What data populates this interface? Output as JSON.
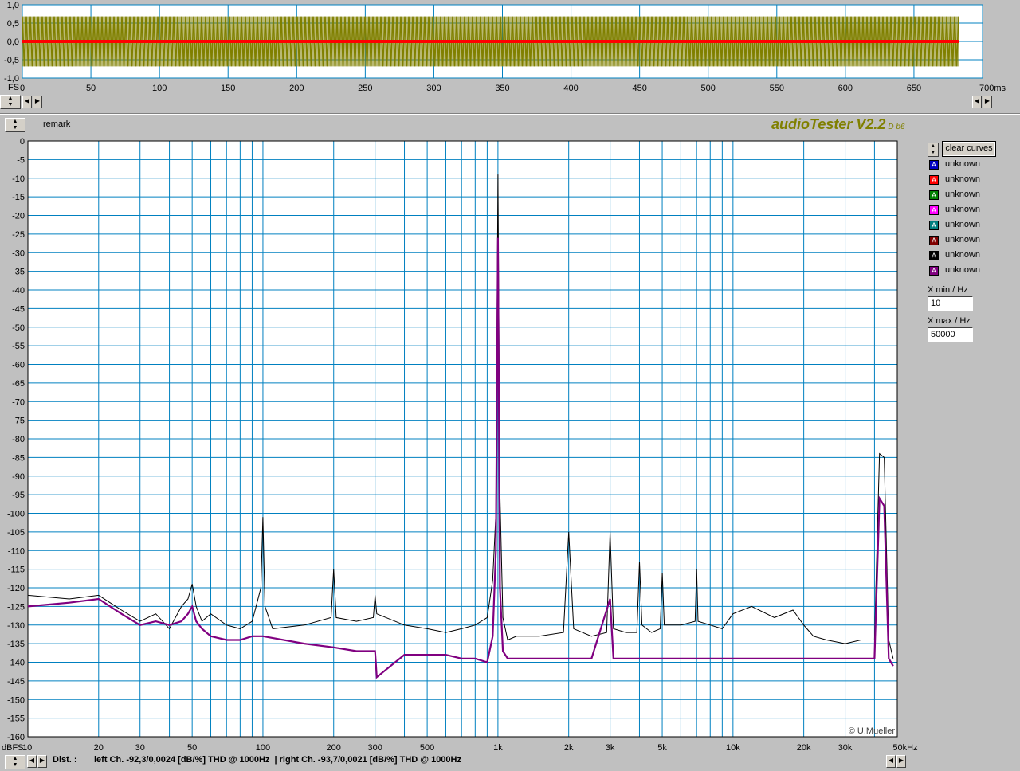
{
  "scope": {
    "y_labels": [
      "1,0",
      "0,5",
      "0,0",
      "-0,5",
      "-1,0"
    ],
    "fs_label": "FS",
    "x_ticks": [
      "0",
      "50",
      "100",
      "150",
      "200",
      "250",
      "300",
      "350",
      "400",
      "450",
      "500",
      "550",
      "600",
      "650",
      "700ms"
    ],
    "colors": {
      "bg": "#ffffff",
      "grid": "#0080c0",
      "wave": "#808000",
      "center": "#ff0000"
    }
  },
  "toolbar": {
    "remark_label": "remark",
    "app_title": "audioTester V2.2",
    "app_version": "D b6",
    "clear_button": "clear curves"
  },
  "spectrum": {
    "y_unit": "dBFS",
    "y_ticks": [
      "0",
      "-5",
      "-10",
      "-15",
      "-20",
      "-25",
      "-30",
      "-35",
      "-40",
      "-45",
      "-50",
      "-55",
      "-60",
      "-65",
      "-70",
      "-75",
      "-80",
      "-85",
      "-90",
      "-95",
      "-100",
      "-105",
      "-110",
      "-115",
      "-120",
      "-125",
      "-130",
      "-135",
      "-140",
      "-145",
      "-150",
      "-155",
      "-160"
    ],
    "x_ticks": [
      {
        "label": "10",
        "f": 10
      },
      {
        "label": "20",
        "f": 20
      },
      {
        "label": "30",
        "f": 30
      },
      {
        "label": "50",
        "f": 50
      },
      {
        "label": "100",
        "f": 100
      },
      {
        "label": "200",
        "f": 200
      },
      {
        "label": "300",
        "f": 300
      },
      {
        "label": "500",
        "f": 500
      },
      {
        "label": "1k",
        "f": 1000
      },
      {
        "label": "2k",
        "f": 2000
      },
      {
        "label": "3k",
        "f": 3000
      },
      {
        "label": "5k",
        "f": 5000
      },
      {
        "label": "10k",
        "f": 10000
      },
      {
        "label": "20k",
        "f": 20000
      },
      {
        "label": "30k",
        "f": 30000
      },
      {
        "label": "50kHz",
        "f": 50000
      }
    ],
    "copyright": "© U.Mueller"
  },
  "legend": [
    {
      "label": "unknown",
      "color": "#0000c0",
      "icon": "triangle-icon"
    },
    {
      "label": "unknown",
      "color": "#ff0000",
      "icon": "triangle-icon"
    },
    {
      "label": "unknown",
      "color": "#008000",
      "icon": "triangle-icon"
    },
    {
      "label": "unknown",
      "color": "#ff00ff",
      "icon": "triangle-icon"
    },
    {
      "label": "unknown",
      "color": "#008080",
      "icon": "triangle-icon"
    },
    {
      "label": "unknown",
      "color": "#800000",
      "icon": "triangle-icon"
    },
    {
      "label": "unknown",
      "color": "#000000",
      "icon": "triangle-icon"
    },
    {
      "label": "unknown",
      "color": "#800080",
      "icon": "triangle-icon"
    }
  ],
  "controls": {
    "xmin_label": "X min / Hz",
    "xmin_value": "10",
    "xmax_label": "X max / Hz",
    "xmax_value": "50000"
  },
  "status": {
    "dist_label": "Dist. :",
    "dist_text": "left Ch. -92,3/0,0024 [dB/%] THD @ 1000Hz  | right Ch. -93,7/0,0021 [dB/%] THD @ 1000Hz"
  },
  "chart_data": {
    "type": "line",
    "title": "",
    "xlabel": "",
    "ylabel": "dBFS",
    "x_scale": "log",
    "xlim": [
      10,
      50000
    ],
    "ylim": [
      -160,
      0
    ],
    "grid": true,
    "series": [
      {
        "color": "#000000",
        "x": [
          10,
          15,
          20,
          25,
          30,
          35,
          40,
          45,
          48,
          50,
          52,
          55,
          60,
          70,
          80,
          90,
          98,
          100,
          102,
          110,
          150,
          195,
          200,
          205,
          250,
          295,
          300,
          305,
          400,
          500,
          600,
          700,
          800,
          900,
          950,
          980,
          1000,
          1020,
          1050,
          1100,
          1200,
          1500,
          1900,
          2000,
          2100,
          2500,
          2900,
          3000,
          3100,
          3500,
          3900,
          4000,
          4100,
          4500,
          4900,
          5000,
          5100,
          6000,
          6900,
          7000,
          7100,
          8000,
          9000,
          10000,
          12000,
          15000,
          18000,
          20000,
          22000,
          25000,
          30000,
          35000,
          40000,
          42000,
          44000,
          46000,
          48000
        ],
        "y": [
          -122,
          -123,
          -122,
          -126,
          -129,
          -127,
          -131,
          -125,
          -123,
          -119,
          -125,
          -129,
          -127,
          -130,
          -131,
          -129,
          -120,
          -101,
          -125,
          -131,
          -130,
          -128,
          -115,
          -128,
          -129,
          -128,
          -122,
          -127,
          -130,
          -131,
          -132,
          -131,
          -130,
          -128,
          -118,
          -100,
          -9,
          -95,
          -128,
          -134,
          -133,
          -133,
          -132,
          -105,
          -131,
          -133,
          -132,
          -105,
          -131,
          -132,
          -132,
          -113,
          -130,
          -132,
          -131,
          -116,
          -130,
          -130,
          -129,
          -115,
          -129,
          -130,
          -131,
          -127,
          -125,
          -128,
          -126,
          -130,
          -133,
          -134,
          -135,
          -134,
          -134,
          -84,
          -85,
          -134,
          -139
        ]
      },
      {
        "color": "#800080",
        "x": [
          10,
          15,
          20,
          25,
          30,
          35,
          40,
          45,
          48,
          50,
          52,
          55,
          60,
          70,
          80,
          90,
          100,
          150,
          200,
          250,
          300,
          305,
          400,
          500,
          600,
          700,
          800,
          900,
          950,
          980,
          1000,
          1020,
          1050,
          1100,
          1200,
          1500,
          2000,
          2500,
          3000,
          3100,
          4000,
          5000,
          6000,
          7000,
          8000,
          10000,
          15000,
          20000,
          25000,
          30000,
          35000,
          40000,
          42000,
          44000,
          46000,
          48000
        ],
        "y": [
          -125,
          -124,
          -123,
          -127,
          -130,
          -129,
          -130,
          -129,
          -127,
          -125,
          -129,
          -131,
          -133,
          -134,
          -134,
          -133,
          -133,
          -135,
          -136,
          -137,
          -137,
          -144,
          -138,
          -138,
          -138,
          -139,
          -139,
          -140,
          -133,
          -110,
          -26,
          -120,
          -137,
          -139,
          -139,
          -139,
          -139,
          -139,
          -123,
          -139,
          -139,
          -139,
          -139,
          -139,
          -139,
          -139,
          -139,
          -139,
          -139,
          -139,
          -139,
          -139,
          -96,
          -98,
          -139,
          -141
        ]
      }
    ]
  }
}
